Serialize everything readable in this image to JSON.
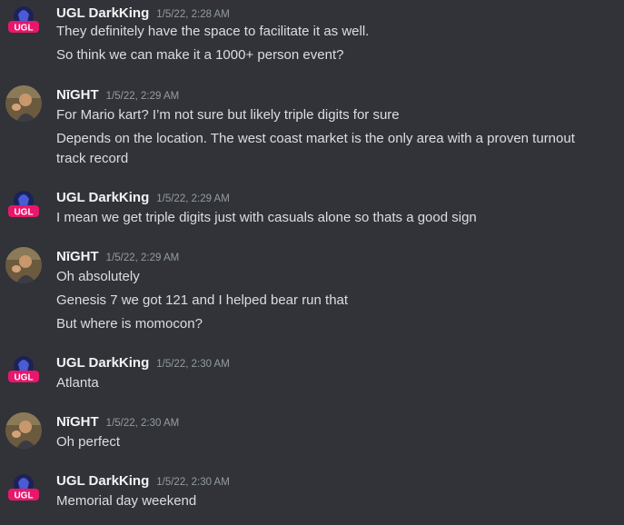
{
  "colors": {
    "background": "#313338",
    "username": "#f2f3f5",
    "timestamp": "#949ba4",
    "text": "#dbdee1",
    "ugl_pink": "#e8176b",
    "ugl_navy": "#1c2257"
  },
  "messages": [
    {
      "author": "UGL DarkKing",
      "avatar": "ugl-logo",
      "avatar_text": "UGL",
      "time": "1/5/22, 2:28 AM",
      "lines": [
        "They definitely have the space to facilitate it as well.",
        "So think we can make it a 1000+ person event?"
      ]
    },
    {
      "author": "NīGHT",
      "avatar": "photo",
      "time": "1/5/22, 2:29 AM",
      "lines": [
        "For Mario kart? I’m not sure but likely triple digits for sure",
        "Depends on the location. The west coast market is the only area with a proven turnout",
        "track record"
      ]
    },
    {
      "author": "UGL DarkKing",
      "avatar": "ugl-logo",
      "avatar_text": "UGL",
      "time": "1/5/22, 2:29 AM",
      "lines": [
        "I mean we get triple digits just with casuals alone so thats a good sign"
      ]
    },
    {
      "author": "NīGHT",
      "avatar": "photo",
      "time": "1/5/22, 2:29 AM",
      "lines": [
        "Oh absolutely",
        "Genesis 7 we got 121 and I helped bear run that",
        "But where is momocon?"
      ]
    },
    {
      "author": "UGL DarkKing",
      "avatar": "ugl-logo",
      "avatar_text": "UGL",
      "time": "1/5/22, 2:30 AM",
      "lines": [
        "Atlanta"
      ]
    },
    {
      "author": "NīGHT",
      "avatar": "photo",
      "time": "1/5/22, 2:30 AM",
      "lines": [
        "Oh perfect"
      ]
    },
    {
      "author": "UGL DarkKing",
      "avatar": "ugl-logo",
      "avatar_text": "UGL",
      "time": "1/5/22, 2:30 AM",
      "lines": [
        "Memorial day weekend"
      ]
    }
  ]
}
